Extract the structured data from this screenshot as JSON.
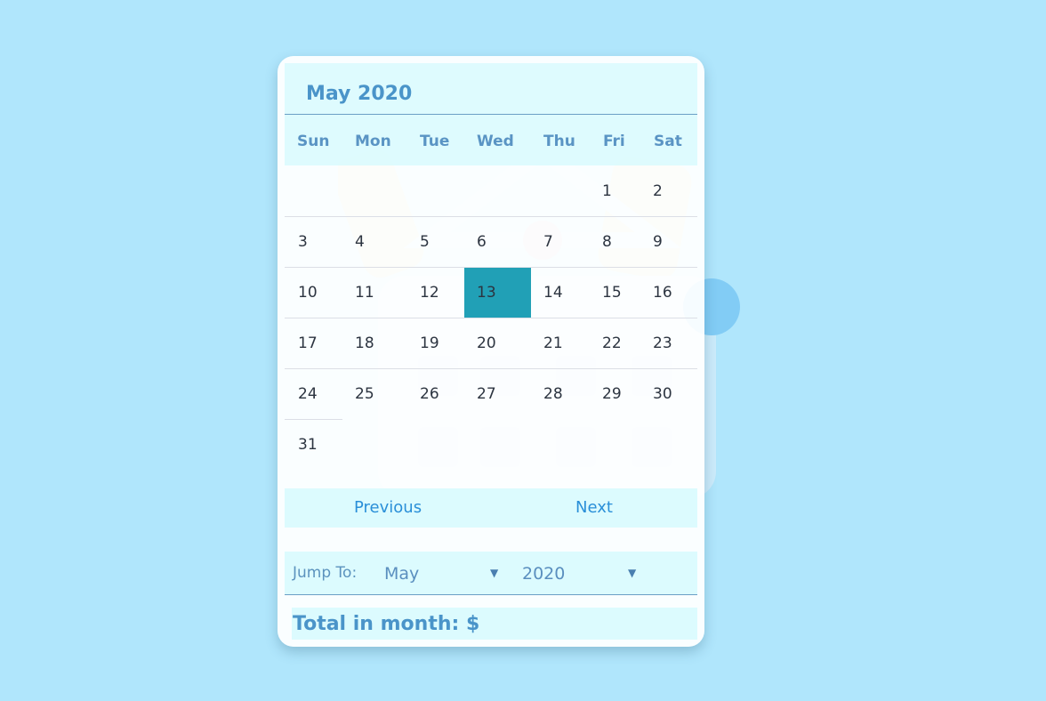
{
  "calendar": {
    "title": "May 2020",
    "weekdays": [
      "Sun",
      "Mon",
      "Tue",
      "Wed",
      "Thu",
      "Fri",
      "Sat"
    ],
    "selected_day": "13",
    "days": [
      "1",
      "2",
      "3",
      "4",
      "5",
      "6",
      "7",
      "8",
      "9",
      "10",
      "11",
      "12",
      "13",
      "14",
      "15",
      "16",
      "17",
      "18",
      "19",
      "20",
      "21",
      "22",
      "23",
      "24",
      "25",
      "26",
      "27",
      "28",
      "29",
      "30",
      "31"
    ]
  },
  "nav": {
    "previous": "Previous",
    "next": "Next"
  },
  "jump": {
    "label": "Jump To:",
    "month": "May",
    "year": "2020"
  },
  "total": {
    "label": "Total in month: $"
  },
  "colors": {
    "background": "#b0e6fc",
    "accent": "#4a94c9",
    "selected": "#21a0b6",
    "link": "#2a8fd8"
  }
}
